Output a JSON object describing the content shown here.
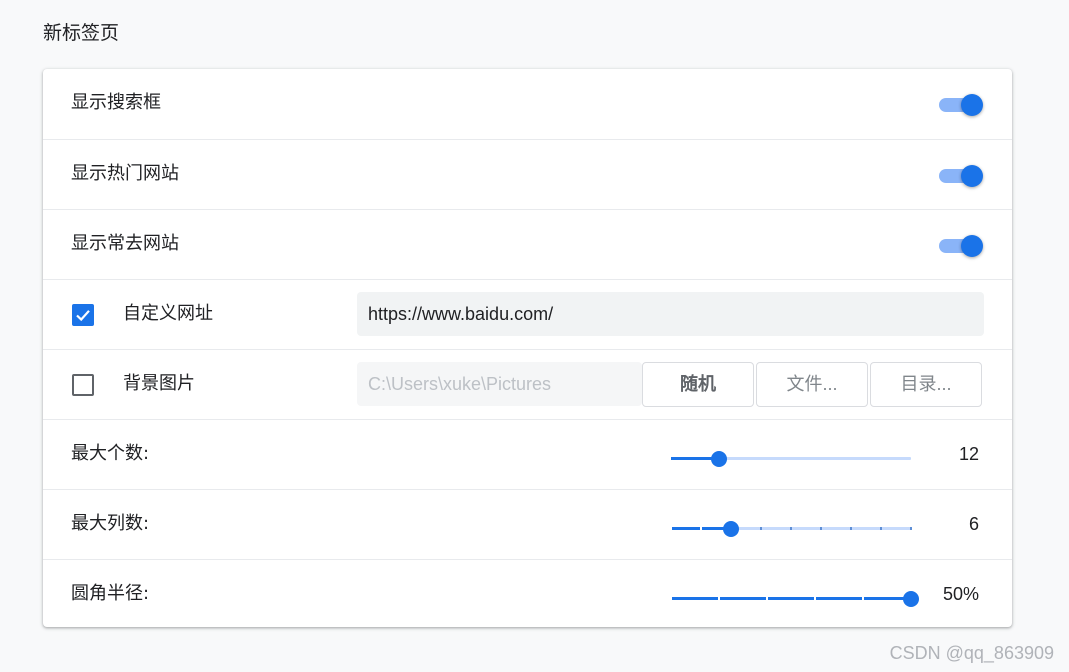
{
  "section": {
    "title": "新标签页"
  },
  "rows": {
    "show_search": {
      "label": "显示搜索框",
      "on": true
    },
    "show_hot": {
      "label": "显示热门网站",
      "on": true
    },
    "show_frequent": {
      "label": "显示常去网站",
      "on": true
    },
    "custom_url": {
      "label": "自定义网址",
      "checked": true,
      "value": "https://www.baidu.com/"
    },
    "background": {
      "label": "背景图片",
      "checked": false,
      "placeholder": "C:\\Users\\xuke\\Pictures",
      "random_label": "随机",
      "files_label": "文件...",
      "dirs_label": "目录..."
    },
    "max_count": {
      "label": "最大个数:",
      "value": "12",
      "fraction": 0.2
    },
    "max_cols": {
      "label": "最大列数:",
      "value": "6",
      "fraction": 0.25,
      "ticks": 9
    },
    "radius": {
      "label": "圆角半径:",
      "value": "50%",
      "fraction": 1.0,
      "ticks": 6
    }
  },
  "colors": {
    "accent": "#1a73e8",
    "accent_light": "#8ab4f8",
    "rail": "#c6dafc"
  },
  "watermark": "CSDN @qq_863909"
}
